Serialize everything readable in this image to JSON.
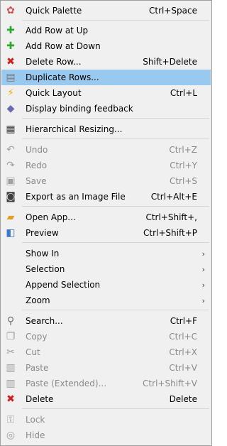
{
  "menu": {
    "items": [
      {
        "label": "Quick Palette",
        "shortcut": "Ctrl+Space",
        "icon": "palette-icon",
        "glyph": "✿",
        "color": "#d05050",
        "disabled": false
      },
      {
        "label": "Add Row at Up",
        "shortcut": "",
        "icon": "add-row-up-icon",
        "glyph": "✚",
        "color": "#2ea82e",
        "disabled": false
      },
      {
        "label": "Add Row at Down",
        "shortcut": "",
        "icon": "add-row-down-icon",
        "glyph": "✚",
        "color": "#2ea82e",
        "disabled": false
      },
      {
        "label": "Delete Row...",
        "shortcut": "Shift+Delete",
        "icon": "delete-row-icon",
        "glyph": "✖",
        "color": "#d02020",
        "disabled": false
      },
      {
        "label": "Duplicate Rows...",
        "shortcut": "",
        "icon": "duplicate-rows-icon",
        "glyph": "▤",
        "color": "#7a7a7a",
        "disabled": false,
        "highlighted": true
      },
      {
        "label": "Quick Layout",
        "shortcut": "Ctrl+L",
        "icon": "lightning-icon",
        "glyph": "⚡",
        "color": "#e8b000",
        "disabled": false
      },
      {
        "label": "Display binding feedback",
        "shortcut": "",
        "icon": "binding-feedback-icon",
        "glyph": "◆",
        "color": "#6a6ab0",
        "disabled": false
      },
      {
        "label": "Hierarchical Resizing...",
        "shortcut": "",
        "icon": "hierarchical-resize-icon",
        "glyph": "▦",
        "color": "#404040",
        "disabled": false
      },
      {
        "label": "Undo",
        "shortcut": "Ctrl+Z",
        "icon": "undo-icon",
        "glyph": "↶",
        "color": "#a0a0a0",
        "disabled": true
      },
      {
        "label": "Redo",
        "shortcut": "Ctrl+Y",
        "icon": "redo-icon",
        "glyph": "↷",
        "color": "#a0a0a0",
        "disabled": true
      },
      {
        "label": "Save",
        "shortcut": "Ctrl+S",
        "icon": "save-icon",
        "glyph": "▣",
        "color": "#a0a0a0",
        "disabled": true
      },
      {
        "label": "Export as an Image File",
        "shortcut": "Ctrl+Alt+E",
        "icon": "camera-icon",
        "glyph": "◙",
        "color": "#404040",
        "disabled": false
      },
      {
        "label": "Open App...",
        "shortcut": "Ctrl+Shift+,",
        "icon": "open-folder-icon",
        "glyph": "▰",
        "color": "#e0a020",
        "disabled": false
      },
      {
        "label": "Preview",
        "shortcut": "Ctrl+Shift+P",
        "icon": "preview-icon",
        "glyph": "◧",
        "color": "#3a78c8",
        "disabled": false
      },
      {
        "label": "Show In",
        "shortcut": "",
        "submenu": true,
        "disabled": false
      },
      {
        "label": "Selection",
        "shortcut": "",
        "submenu": true,
        "disabled": false
      },
      {
        "label": "Append Selection",
        "shortcut": "",
        "submenu": true,
        "disabled": false
      },
      {
        "label": "Zoom",
        "shortcut": "",
        "submenu": true,
        "disabled": false
      },
      {
        "label": "Search...",
        "shortcut": "Ctrl+F",
        "icon": "search-icon",
        "glyph": "⚲",
        "color": "#707070",
        "disabled": false
      },
      {
        "label": "Copy",
        "shortcut": "Ctrl+C",
        "icon": "copy-icon",
        "glyph": "❐",
        "color": "#a0a0a0",
        "disabled": true
      },
      {
        "label": "Cut",
        "shortcut": "Ctrl+X",
        "icon": "scissors-icon",
        "glyph": "✂",
        "color": "#a0a0a0",
        "disabled": true
      },
      {
        "label": "Paste",
        "shortcut": "Ctrl+V",
        "icon": "paste-icon",
        "glyph": "▥",
        "color": "#a0a0a0",
        "disabled": true
      },
      {
        "label": "Paste (Extended)...",
        "shortcut": "Ctrl+Shift+V",
        "icon": "paste-extended-icon",
        "glyph": "▥",
        "color": "#a0a0a0",
        "disabled": true
      },
      {
        "label": "Delete",
        "shortcut": "Delete",
        "icon": "delete-icon",
        "glyph": "✖",
        "color": "#d02020",
        "disabled": false
      },
      {
        "label": "Lock",
        "shortcut": "",
        "icon": "lock-icon",
        "glyph": "⚿",
        "color": "#a0a0a0",
        "disabled": true
      },
      {
        "label": "Hide",
        "shortcut": "",
        "icon": "hide-eye-icon",
        "glyph": "◎",
        "color": "#a0a0a0",
        "disabled": true
      }
    ],
    "submenu_arrow": "›"
  }
}
